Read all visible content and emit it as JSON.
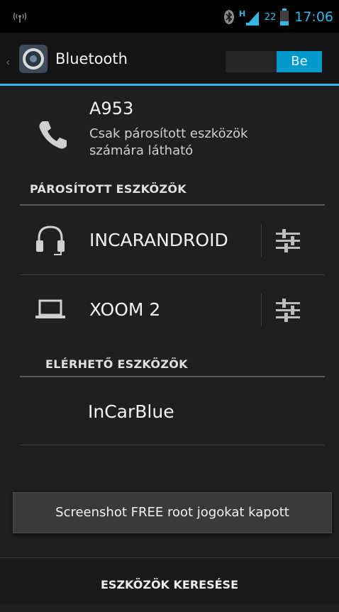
{
  "status_bar": {
    "time": "17:06",
    "battery_level": "22",
    "network_type": "H",
    "icons": [
      "wireless-signal-icon",
      "bluetooth-icon",
      "cell-signal-icon",
      "battery-icon"
    ],
    "accent_color": "#33b5e5"
  },
  "action_bar": {
    "title": "Bluetooth",
    "toggle_label": "Be",
    "toggle_on": true
  },
  "own_device": {
    "name": "A953",
    "visibility": "Csak párosított eszközök számára látható"
  },
  "paired": {
    "header": "PÁROSÍTOTT ESZKÖZÖK",
    "devices": [
      {
        "name": "INCARANDROID",
        "icon": "headset-icon"
      },
      {
        "name": "XOOM 2",
        "icon": "laptop-icon"
      }
    ]
  },
  "available": {
    "header": "ELÉRHETŐ ESZKÖZÖK",
    "devices": [
      {
        "name": "InCarBlue"
      }
    ]
  },
  "toast": {
    "text": "Screenshot FREE root jogokat kapott"
  },
  "bottom": {
    "search_label": "ESZKÖZÖK KERESÉSE"
  }
}
